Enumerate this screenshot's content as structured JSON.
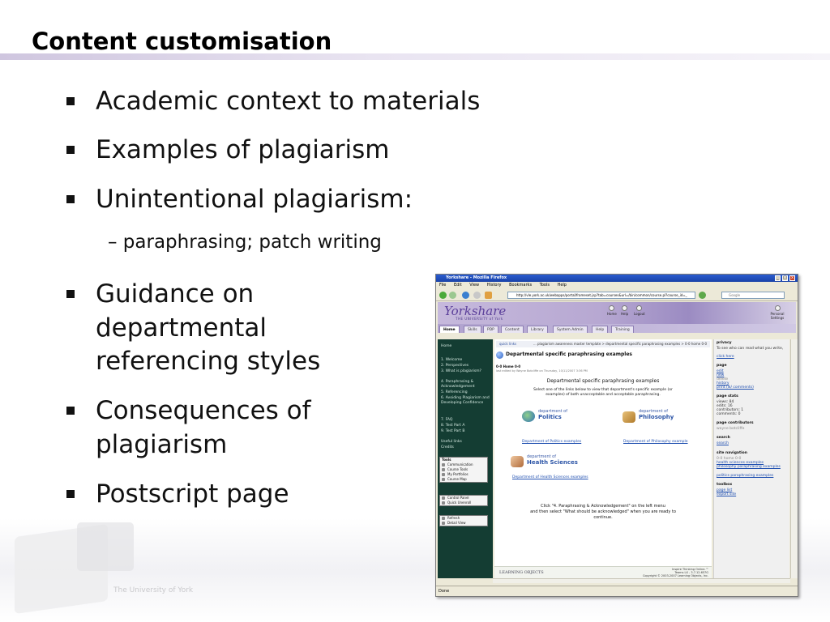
{
  "slide": {
    "title": "Content customisation",
    "bullets": [
      "Academic context to materials",
      "Examples of plagiarism",
      "Unintentional plagiarism:",
      "Guidance on",
      "departmental",
      "referencing styles",
      "Consequences of",
      "plagiarism",
      "Postscript page"
    ],
    "sub_bullet": "– paraphrasing; patch writing",
    "bottom_watermark": "The University of York"
  },
  "browser": {
    "window_title": "Yorkshare - Mozilla Firefox",
    "menu": [
      "File",
      "Edit",
      "View",
      "History",
      "Bookmarks",
      "Tools",
      "Help"
    ],
    "url": "http://vle.york.ac.uk/webapps/portal/frameset.jsp?tab=courses&url=/bin/common/course.pl?course_id=_",
    "search_placeholder": "Google",
    "status_text": "Done"
  },
  "site": {
    "logo": "Yorkshare",
    "logo_sub": "THE UNIVERSITY of York",
    "header_icons": [
      "Home",
      "Help",
      "Logout"
    ],
    "personal_settings": "Personal Settings",
    "tabs": [
      "Home",
      "Skills",
      "PDP",
      "Content",
      "Library",
      "System Admin",
      "Help",
      "Training"
    ],
    "left_nav": {
      "home": "Home",
      "items": [
        "1. Welcome",
        "2. Perspectives",
        "3. What is plagiarism?",
        "4. Paraphrasing & Acknowledgement",
        "5. Referencing",
        "6. Avoiding Plagiarism and Developing Confidence",
        "7. FAQ",
        "8. Test Part A",
        "9. Test Part B",
        "Useful links",
        "Credits"
      ],
      "tools_heading": "Tools",
      "tools": [
        "Communication",
        "Course Tools",
        "My Portfolios",
        "Course Map"
      ],
      "panel": [
        "Control Panel",
        "Quick Unenroll"
      ],
      "refresh": [
        "Refresh",
        "Detail View"
      ]
    },
    "content": {
      "quick_links": "quick links",
      "breadcrumb": "... plagiarism awareness master template > departmental specific paraphrasing examples > 0-0 home 0-0",
      "page_heading": "Departmental specific paraphrasing examples",
      "home_label": "0-0 Home 0-0",
      "updated": "last edited by Wayne Botcliffe on Thursday, 10/11/2007 3:36 PM",
      "main_title": "Departmental specific paraphrasing examples",
      "description": "Select one of the links below to view that department's specific example (or examples) of both unacceptable and acceptable paraphrasing.",
      "dept_prefix": "department of",
      "departments": [
        "Politics",
        "Philosophy",
        "Health Sciences"
      ],
      "links": [
        "Department of Politics examples",
        "Department of Philosophy example",
        "Department of Health Sciences examples"
      ],
      "instruction_1": "Click \"4. Paraphrasing & Acknowledgement\" on the left menu",
      "instruction_2": "and then select \"What should be acknowledged\" when you are ready to",
      "instruction_3": "continue.",
      "footer_logo": "LEARNING OBJECTS",
      "footer_copy": [
        "Inspire Thinking Online.™",
        "Teams LX - 3.7.12.657G",
        "Copyright © 2003-2007 Learning Objects, Inc."
      ]
    },
    "right_col": {
      "privacy_h": "privacy",
      "privacy_t": "To see who can read what you write,",
      "privacy_link": "click here",
      "page_h": "page",
      "page_links": [
        "edit",
        "new",
        "delete",
        "history",
        "print (w/ comments)"
      ],
      "stats_h": "page stats",
      "stats": [
        "views: 84",
        "edits: 16",
        "contributors: 1",
        "comments: 0"
      ],
      "contrib_h": "page contributors",
      "contrib": "wayne botcliffe",
      "search_h": "search",
      "search_link": "search",
      "sitenav_h": "site navigation",
      "sitenav": [
        "0-0 home 0-0",
        "health sciences examples",
        "philosophy paraphrasing examples",
        "politics paraphrasing examples"
      ],
      "toolbox_h": "toolbox",
      "toolbox": [
        "page list",
        "export site"
      ]
    }
  }
}
